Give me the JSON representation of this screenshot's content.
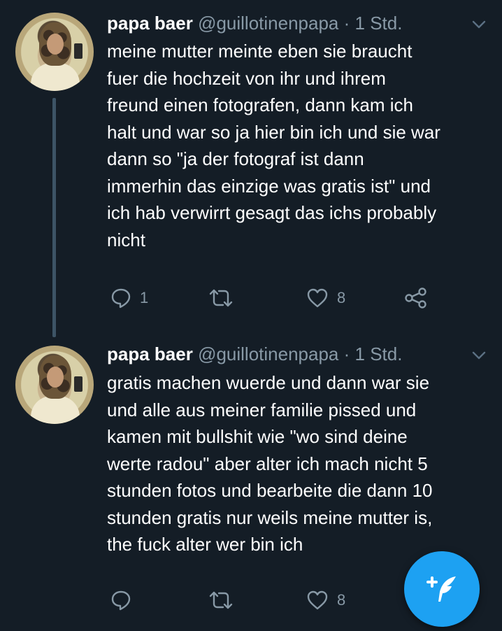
{
  "tweets": [
    {
      "name": "papa baer",
      "handle": "@guillotinenpapa",
      "separator": "·",
      "time": "1 Std.",
      "lines": [
        "meine mutter meinte eben sie braucht",
        "fuer die hochzeit von ihr und ihrem",
        "freund einen fotografen, dann kam ich",
        "halt und war so ja hier bin ich und sie war",
        "dann so \"ja der fotograf ist dann",
        "immerhin das einzige was gratis ist\" und",
        "ich hab verwirrt gesagt das ichs probably",
        "nicht"
      ],
      "reply_count": "1",
      "retweet_count": "",
      "like_count": "8"
    },
    {
      "name": "papa baer",
      "handle": "@guillotinenpapa",
      "separator": "·",
      "time": "1 Std.",
      "lines": [
        "gratis machen wuerde und dann war sie",
        "und alle aus meiner familie pissed und",
        "kamen mit bullshit wie \"wo sind deine",
        "werte radou\" aber alter ich mach nicht 5",
        "stunden fotos und bearbeite die dann 10",
        "stunden gratis nur weils meine mutter is,",
        "the fuck alter wer bin ich"
      ],
      "reply_count": "",
      "retweet_count": "",
      "like_count": "8"
    }
  ],
  "icons": {
    "reply": "reply-icon",
    "retweet": "retweet-icon",
    "like": "heart-icon",
    "share": "share-icon",
    "more": "chevron-down-icon",
    "compose": "compose-tweet-icon"
  },
  "colors": {
    "background": "#141d26",
    "text": "#ffffff",
    "secondary": "#8899a6",
    "accent": "#1da1f2",
    "thread_line": "#3d5466"
  }
}
